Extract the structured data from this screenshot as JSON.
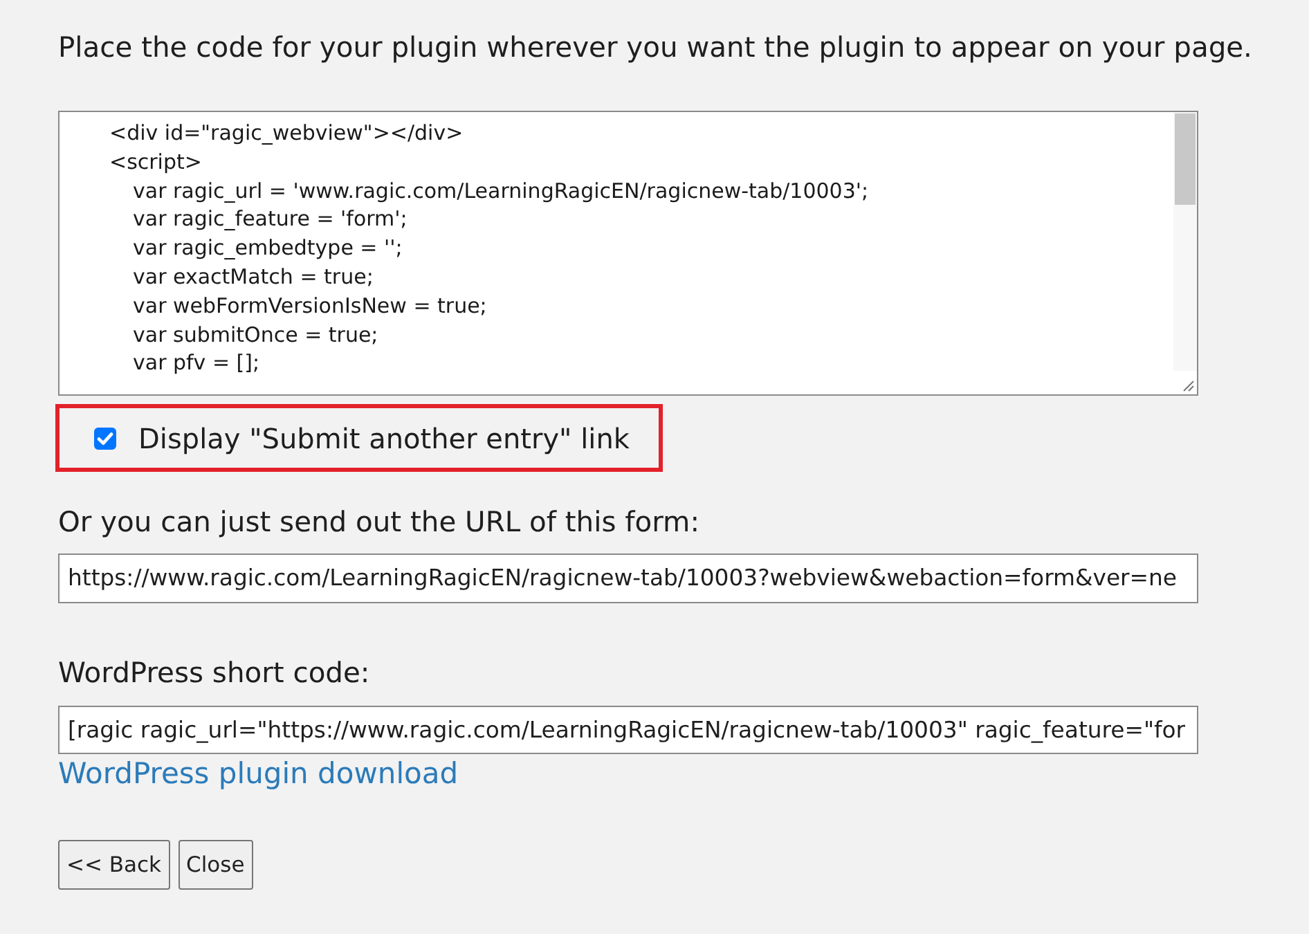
{
  "instruction": "Place the code for your plugin wherever you want the plugin to appear on your page.",
  "embed_code": {
    "lines": [
      {
        "text": "<div id=\"ragic_webview\"></div>"
      },
      {
        "text": "<script>",
        "children": [
          {
            "text": "var ragic_url = 'www.ragic.com/LearningRagicEN/ragicnew-tab/10003';"
          },
          {
            "text": "var ragic_feature = 'form';"
          },
          {
            "text": "var ragic_embedtype = '';"
          },
          {
            "text": "var exactMatch = true;"
          },
          {
            "text": "var webFormVersionIsNew = true;"
          },
          {
            "text": "var submitOnce = true;"
          },
          {
            "text": "var pfv = [];"
          }
        ]
      }
    ]
  },
  "submit_another_option": {
    "label": "Display \"Submit another entry\" link",
    "checked": true,
    "highlighted": true
  },
  "url_section": {
    "label": "Or you can just send out the URL of this form:",
    "value": "https://www.ragic.com/LearningRagicEN/ragicnew-tab/10003?webview&webaction=form&ver=ne"
  },
  "wordpress_section": {
    "label": "WordPress short code:",
    "value": "[ragic ragic_url=\"https://www.ragic.com/LearningRagicEN/ragicnew-tab/10003\" ragic_feature=\"for",
    "link": "WordPress plugin download"
  },
  "buttons": [
    {
      "label": "<< Back"
    },
    {
      "label": "Close"
    }
  ]
}
